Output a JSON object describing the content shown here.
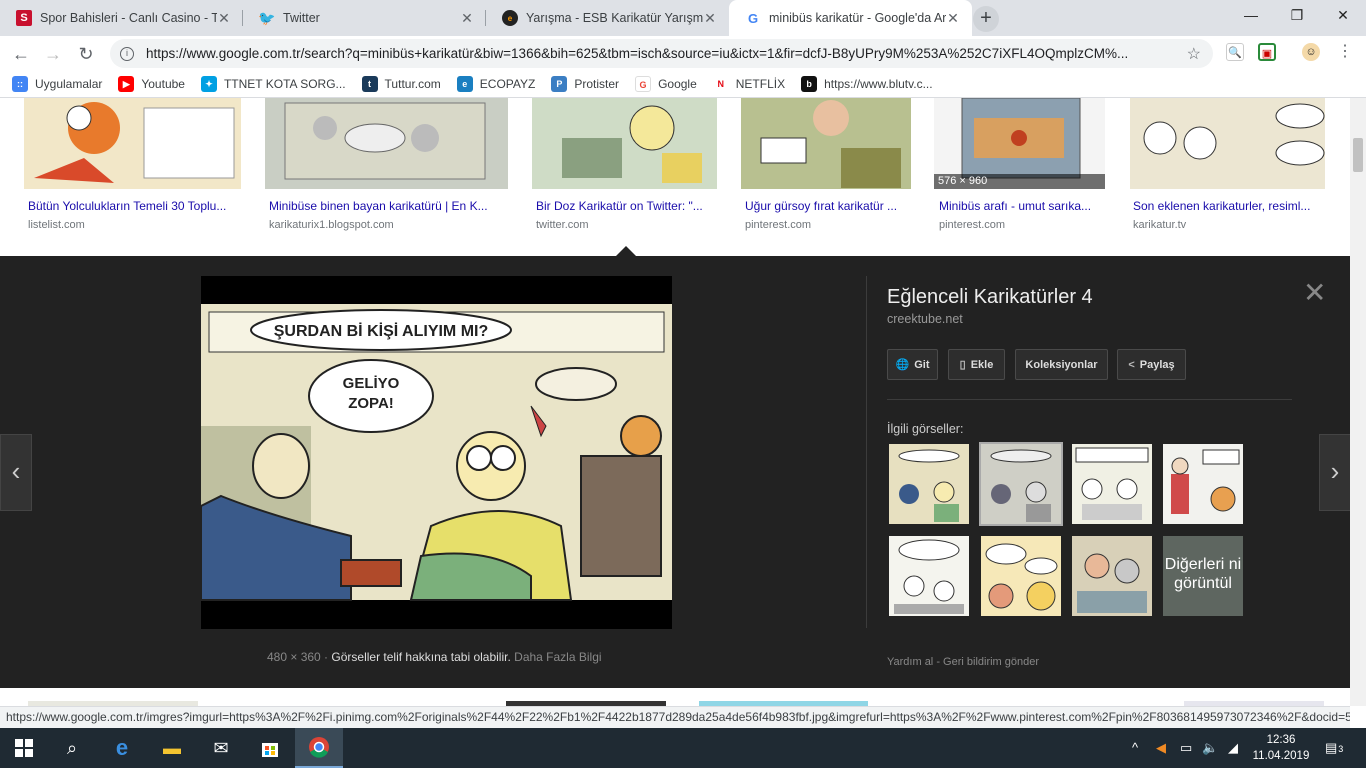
{
  "tabs": [
    {
      "title": "Spor Bahisleri - Canlı Casino - Tombala",
      "icon": "S"
    },
    {
      "title": "Twitter",
      "icon": "t"
    },
    {
      "title": "Yarışma - ESB Karikatür Yarışması",
      "icon": "e"
    },
    {
      "title": "minibüs karikatür - Google'da Ara",
      "icon": "G"
    }
  ],
  "toolbar": {
    "url": "https://www.google.com.tr/search?q=minibüs+karikatür&biw=1366&bih=625&tbm=isch&source=iu&ictx=1&fir=dcfJ-B8yUPry9M%253A%252C7iXFL4OQmplzCM%..."
  },
  "bookmarks": [
    {
      "label": "Uygulamalar",
      "color": "#4285f4",
      "g": "::"
    },
    {
      "label": "Youtube",
      "color": "#ff0000",
      "g": "▶"
    },
    {
      "label": "TTNET KOTA SORG...",
      "color": "#00a0e3",
      "g": "✦"
    },
    {
      "label": "Tuttur.com",
      "color": "#1a3a5a",
      "g": "t"
    },
    {
      "label": "ECOPAYZ",
      "color": "#1a7fc1",
      "g": "e"
    },
    {
      "label": "Protister",
      "color": "#3b7ec3",
      "g": "P"
    },
    {
      "label": "Google",
      "color": "#ea4335",
      "g": "G"
    },
    {
      "label": "NETFLİX",
      "color": "#e50914",
      "g": "N"
    },
    {
      "label": "https://www.blutv.c...",
      "color": "#111",
      "g": "b"
    }
  ],
  "results": [
    {
      "caption": "Bütün Yolculukların Temeli 30 Toplu...",
      "source": "listelist.com"
    },
    {
      "caption": "Minibüse binen bayan karikatürü | En K...",
      "source": "karikaturix1.blogspot.com"
    },
    {
      "caption": "Bir Doz Karikatür on Twitter: \"...",
      "source": "twitter.com"
    },
    {
      "caption": "Uğur gürsoy fırat karikatür ...",
      "source": "pinterest.com"
    },
    {
      "caption": "Minibüs arafı - umut sarıka...",
      "source": "pinterest.com"
    },
    {
      "caption": "Son eklenen karikaturler, resiml...",
      "source": "karikatur.tv"
    }
  ],
  "dim_badge": "576 × 960",
  "panel": {
    "title": "Eğlenceli Karikatürler 4",
    "site": "creektube.net",
    "buttons": {
      "go": "Git",
      "add": "Ekle",
      "collections": "Koleksiyonlar",
      "share": "Paylaş"
    },
    "related_label": "İlgili görseller:",
    "more_label": "Diğerleri ni görüntül",
    "image_size": "480 × 360",
    "copyright": "Görseller telif hakkına tabi olabilir.",
    "more_info": "Daha Fazla Bilgi",
    "help": "Yardım al",
    "feedback": "Geri bildirim gönder",
    "bubble1": "ŞURDAN Bİ KİŞİ ALIYIM MI?",
    "bubble2a": "GELİYO",
    "bubble2b": "ZOPA!"
  },
  "status_url": "https://www.google.com.tr/imgres?imgurl=https%3A%2F%2Fi.pinimg.com%2Foriginals%2F44%2F22%2Fb1%2F4422b1877d289da25a4de56f4b983fbf.jpg&imgrefurl=https%3A%2F%2Fwww.pinterest.com%2Fpin%2F803681495973072346%2F&docid=5...",
  "clock": {
    "time": "12:36",
    "date": "11.04.2019"
  },
  "notif_count": "3"
}
